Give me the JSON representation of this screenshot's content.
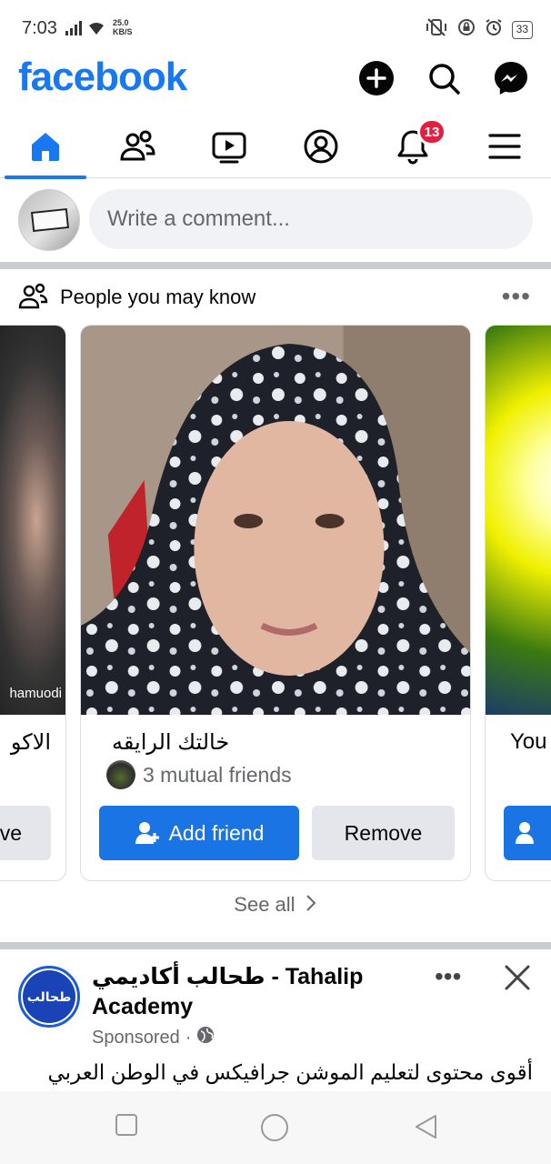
{
  "status_bar": {
    "time": "7:03",
    "net_speed_value": "25.0",
    "net_speed_unit": "KB/S",
    "battery": "33"
  },
  "header": {
    "logo": "facebook",
    "brand_color": "#1877f2",
    "icons": [
      "plus-icon",
      "search-icon",
      "messenger-icon"
    ]
  },
  "tabs": [
    {
      "icon": "home-icon",
      "active": true
    },
    {
      "icon": "friends-icon",
      "active": false
    },
    {
      "icon": "video-icon",
      "active": false
    },
    {
      "icon": "profile-icon",
      "active": false
    },
    {
      "icon": "notifications-icon",
      "active": false,
      "badge": "13"
    },
    {
      "icon": "menu-icon",
      "active": false
    }
  ],
  "composer": {
    "placeholder": "Write a comment..."
  },
  "pymk": {
    "title": "People you may know",
    "see_all": "See all",
    "cards": [
      {
        "name": "الاكو",
        "photo_caption": "hamuodi",
        "remove_label": "ve"
      },
      {
        "name": "خالتك الرايقه",
        "mutual": "3 mutual friends",
        "add_label": "Add friend",
        "remove_label": "Remove"
      },
      {
        "name": "You"
      }
    ]
  },
  "sponsored_post": {
    "page_name": "طحالب أكاديمي - Tahalip Academy",
    "page_name_line1": "طحالب أكاديمي - Tahalip",
    "page_name_line2": "Academy",
    "sponsored_label": "Sponsored",
    "meta_separator": "·",
    "avatar_text": "طحالب",
    "text": "أقوى محتوى لتعليم الموشن جرافيكس في الوطن العربي"
  },
  "colors": {
    "badge": "#e41e3f",
    "button_primary": "#1b74e4",
    "button_secondary": "#e4e6eb",
    "muted_text": "#65676b"
  }
}
